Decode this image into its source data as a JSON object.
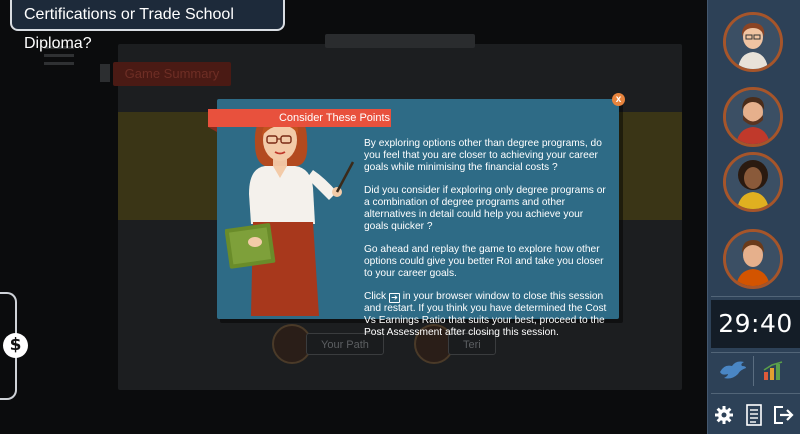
{
  "header": {
    "title": "Certifications or Trade School Diploma?"
  },
  "background": {
    "tab_label": "Game Summary",
    "roles": [
      {
        "label": "Your Path"
      },
      {
        "label": "Teri"
      }
    ]
  },
  "sidebar": {
    "avatars": [
      "avatar-woman-glasses",
      "avatar-man-beard",
      "avatar-woman-curly",
      "avatar-man-worker"
    ],
    "timer": "29:40",
    "icons": [
      "bird-icon",
      "bar-chart-icon",
      "gear-icon",
      "notebook-icon",
      "exit-icon"
    ]
  },
  "left_tab": {
    "symbol": "$"
  },
  "modal": {
    "title": "Consider These Points",
    "close_symbol": "x",
    "paragraphs": [
      "By exploring options other than degree programs, do you feel that you are closer to achieving your career goals while minimising the financial costs ?",
      "Did you consider if exploring only degree programs or a combination of degree programs and other alternatives in detail could help you achieve your goals quicker ?",
      "Go ahead and replay the game to explore how other options could give you better RoI and take you closer to your career goals."
    ],
    "last_prefix": "Click",
    "last_icon_glyph": "➔",
    "last_suffix": "in your browser window  to close this session and restart. If you think you have determined the Cost Vs Earnings Ratio that suits your best,  proceed to the Post Assessment after closing this session."
  },
  "colors": {
    "modal_bg": "#2e6b86",
    "ribbon": "#e8513d",
    "sidebar": "#2d4157",
    "avatar_ring": "#a6552a"
  }
}
